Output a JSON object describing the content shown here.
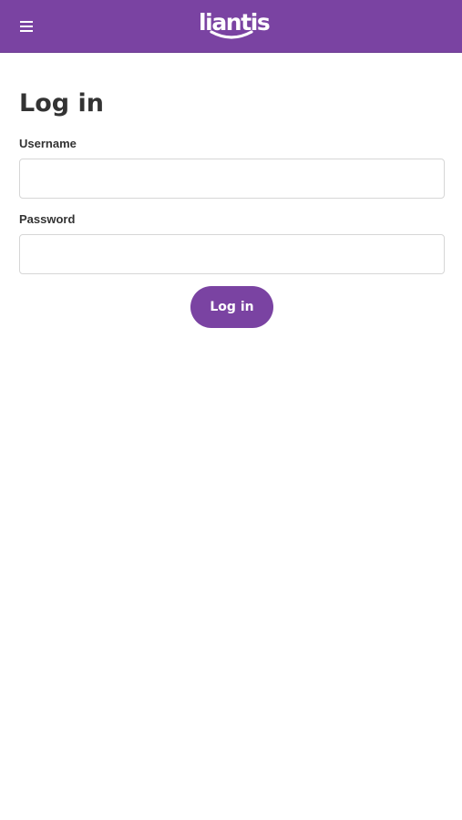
{
  "header": {
    "menu_icon": "hamburger-menu-icon",
    "logo_text": "liantis",
    "brand_color": "#7a43a2",
    "text_color": "#ffffff"
  },
  "login_form": {
    "title": "Log in",
    "username_label": "Username",
    "username_value": "",
    "username_placeholder": "",
    "password_label": "Password",
    "password_value": "",
    "password_placeholder": "",
    "submit_label": "Log in"
  }
}
